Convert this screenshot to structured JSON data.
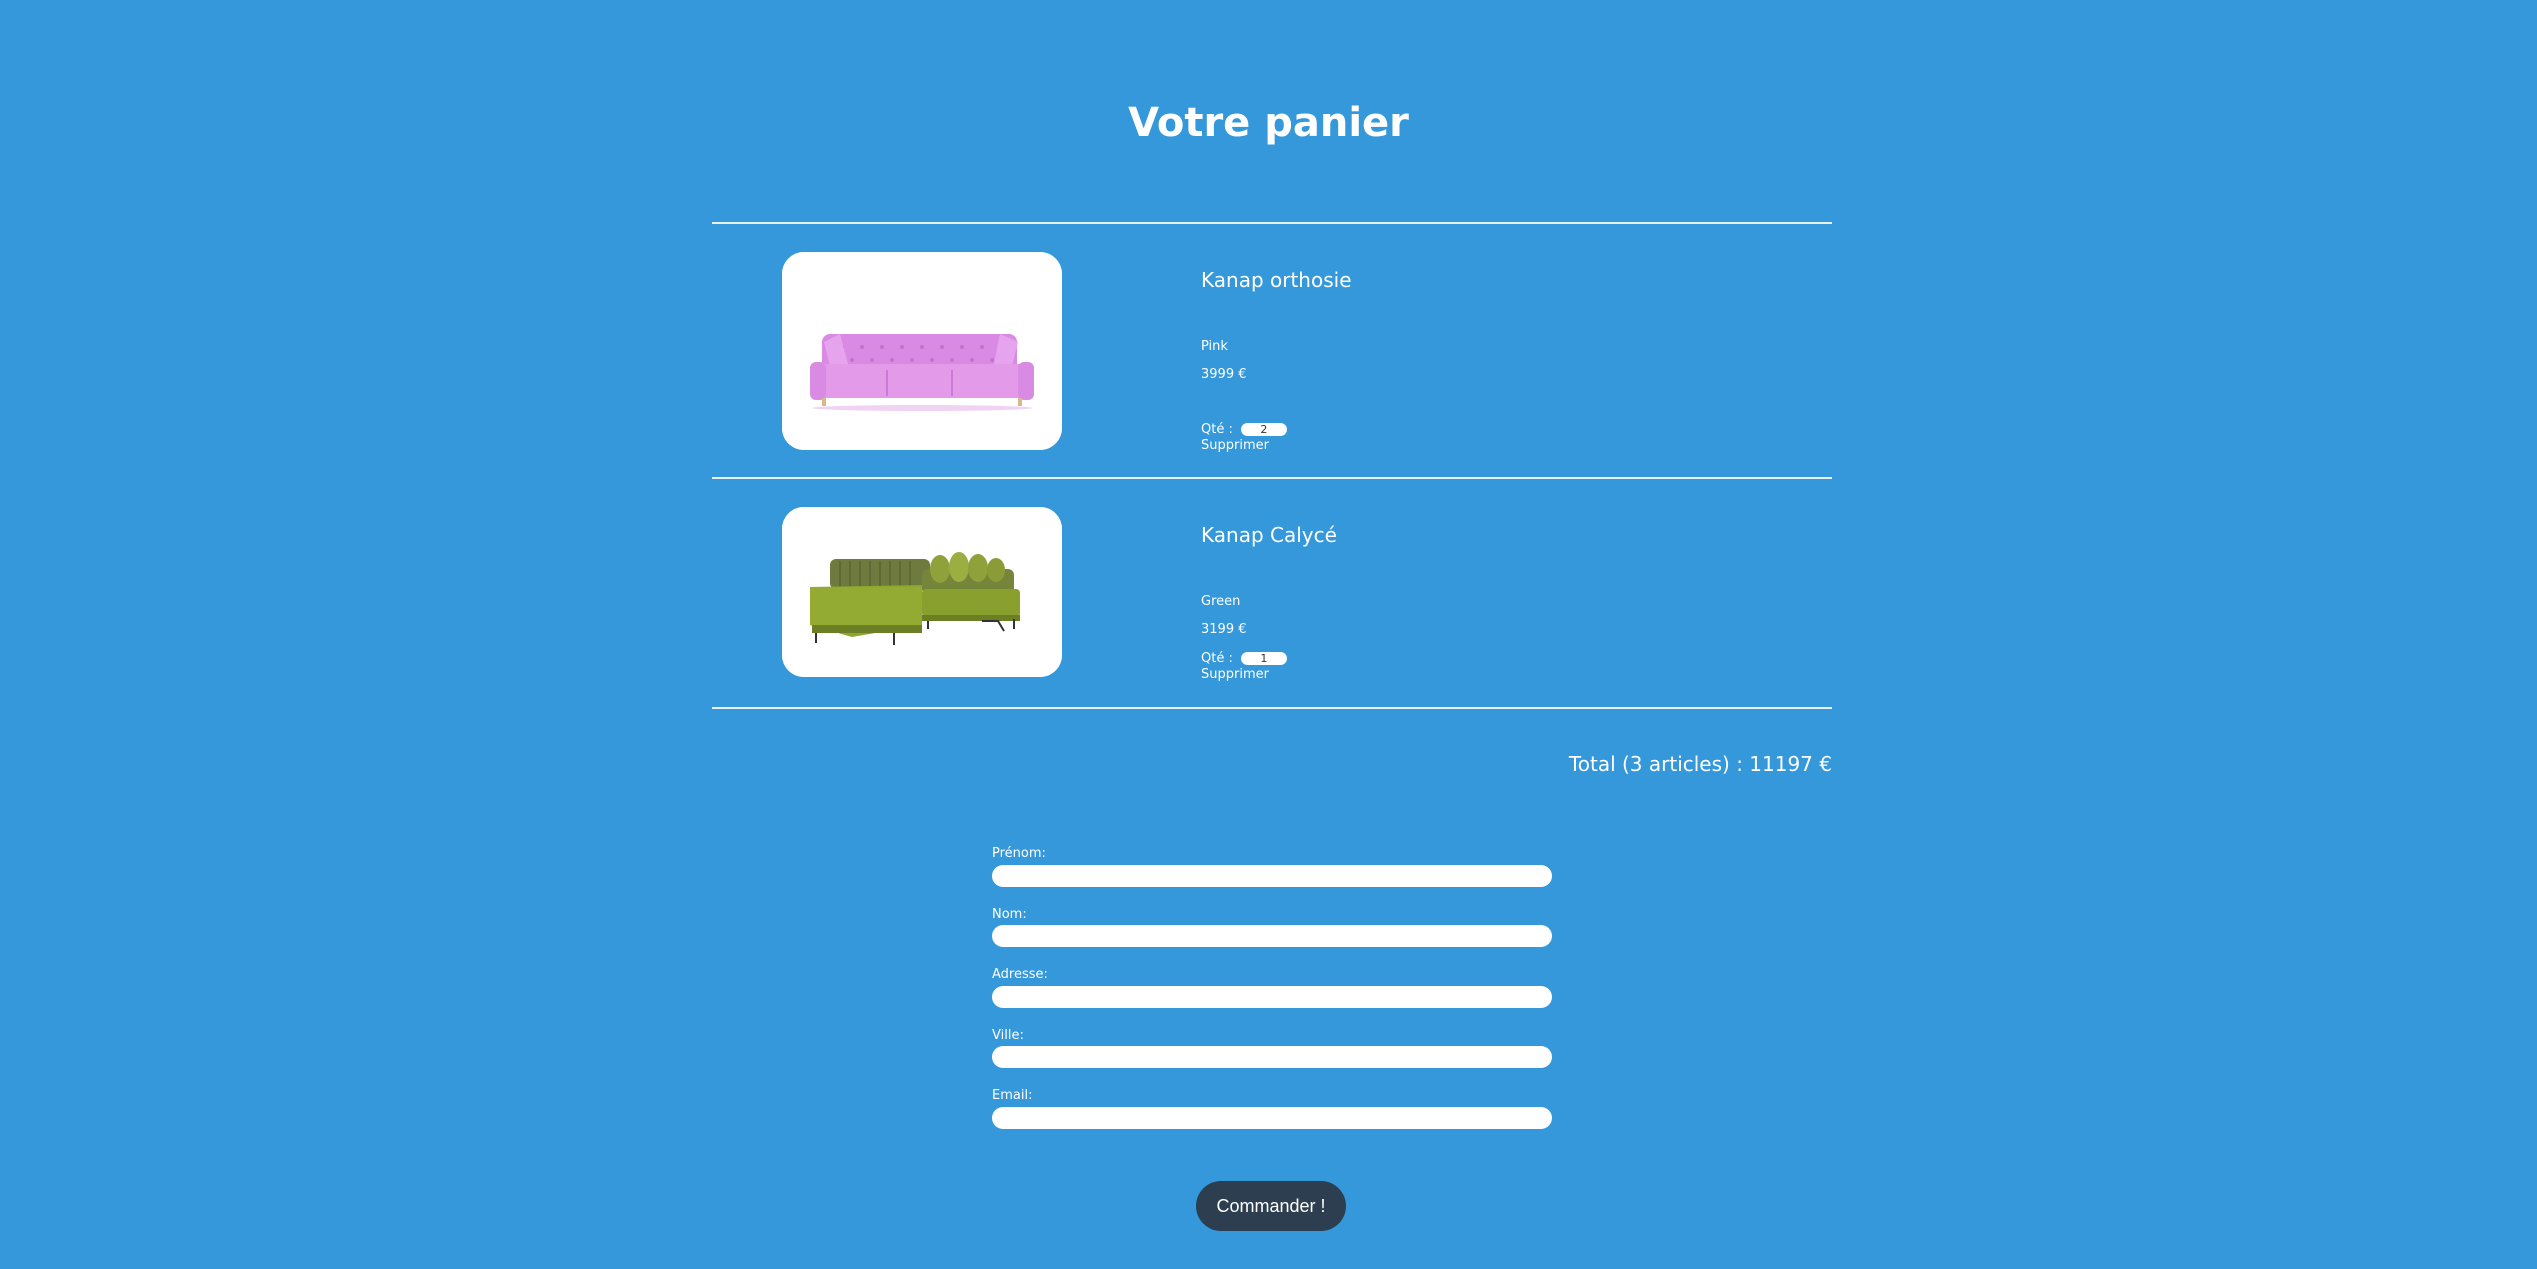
{
  "page": {
    "title": "Votre panier"
  },
  "cart": {
    "items": [
      {
        "name": "Kanap orthosie",
        "color": "Pink",
        "price": "3999 €",
        "qty_label": "Qté :",
        "qty": "2",
        "delete_label": "Supprimer",
        "image": "pink-sofa-image"
      },
      {
        "name": "Kanap Calycé",
        "color": "Green",
        "price": "3199 €",
        "qty_label": "Qté :",
        "qty": "1",
        "delete_label": "Supprimer",
        "image": "green-sectional-sofa-image"
      }
    ],
    "total": "Total (3 articles) : 11197 €"
  },
  "form": {
    "fields": [
      {
        "label": "Prénom:",
        "value": ""
      },
      {
        "label": "Nom:",
        "value": ""
      },
      {
        "label": "Adresse:",
        "value": ""
      },
      {
        "label": "Ville:",
        "value": ""
      },
      {
        "label": "Email:",
        "value": ""
      }
    ],
    "submit_label": "Commander !"
  },
  "colors": {
    "background": "#3498db",
    "button": "#2c3e50",
    "text": "#ffffff"
  }
}
